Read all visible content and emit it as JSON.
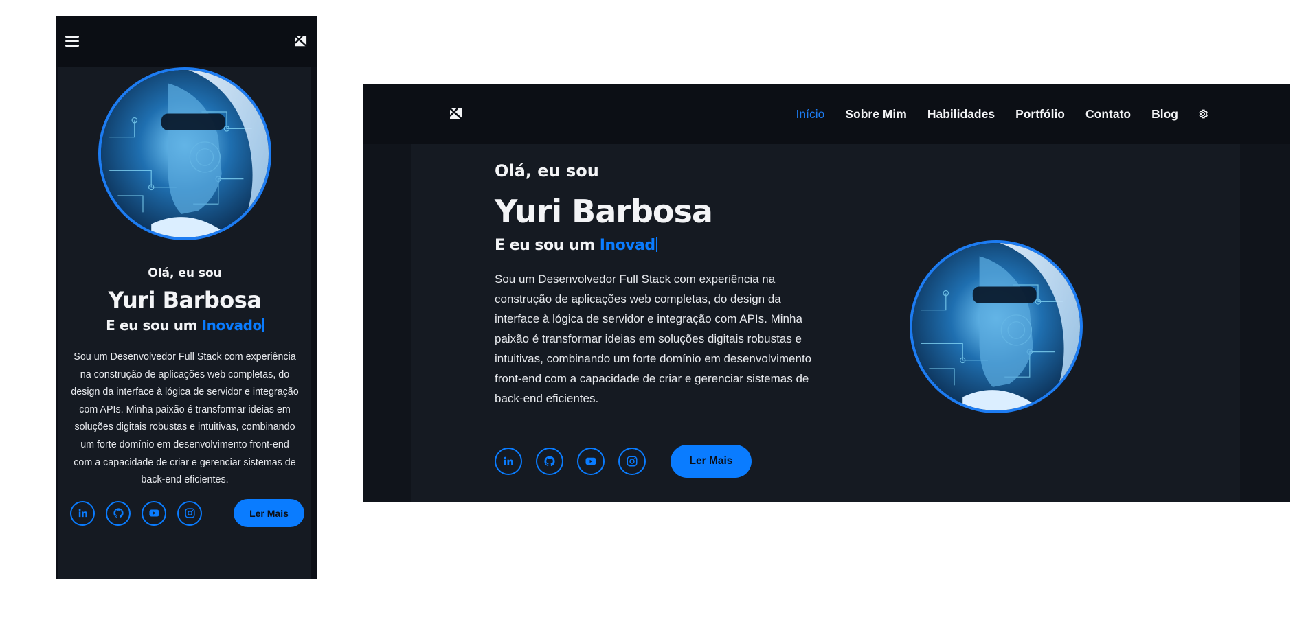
{
  "brand": {
    "accent": "#0a7cff",
    "background": "#0d1017",
    "surface": "#151a22"
  },
  "nav": {
    "items": [
      "Início",
      "Sobre Mim",
      "Habilidades",
      "Portfólio",
      "Contato",
      "Blog"
    ],
    "active": "Início",
    "icons": [
      "hamburger-menu-icon",
      "logo-icon",
      "settings-gear-icon"
    ]
  },
  "hero": {
    "greeting": "Olá, eu sou",
    "name": "Yuri Barbosa",
    "role_prefix": "E eu sou um",
    "role_typed_mobile": "Inovado",
    "role_typed_desktop": "Inovad",
    "description": "Sou um Desenvolvedor Full Stack com experiência na construção de aplicações web completas, do design da interface à lógica de servidor e integração com APIs. Minha paixão é transformar ideias em soluções digitais robustas e intuitivas, combinando um forte domínio em desenvolvimento front-end com a capacidade de criar e gerenciar sistemas de back-end eficientes.",
    "cta_label": "Ler Mais"
  },
  "social": [
    {
      "name": "linkedin",
      "icon": "linkedin-icon"
    },
    {
      "name": "github",
      "icon": "github-icon"
    },
    {
      "name": "youtube",
      "icon": "youtube-icon"
    },
    {
      "name": "instagram",
      "icon": "instagram-icon"
    }
  ]
}
